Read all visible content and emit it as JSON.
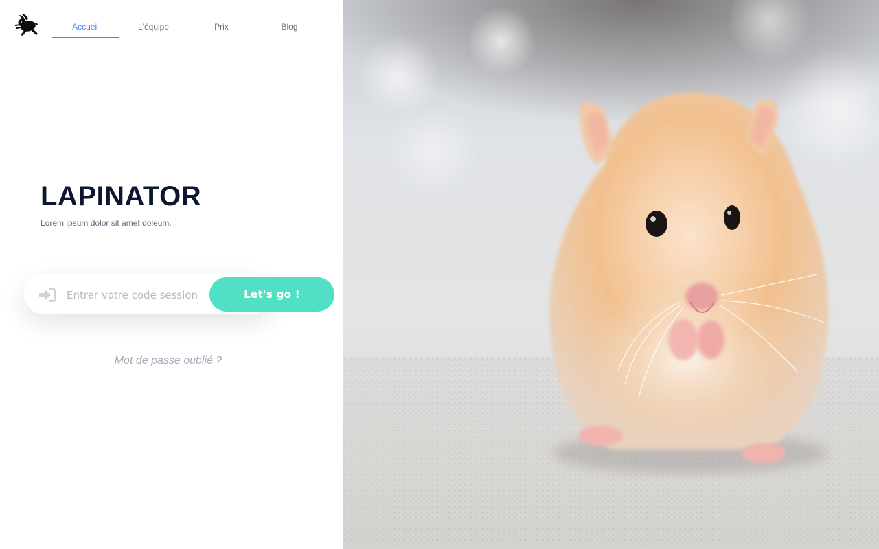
{
  "app": {
    "logo_icon": "running-rabbit-icon"
  },
  "nav": {
    "tabs": [
      {
        "label": "Accueil",
        "active": true
      },
      {
        "label": "L'équipe",
        "active": false
      },
      {
        "label": "Prix",
        "active": false
      },
      {
        "label": "Blog",
        "active": false
      }
    ]
  },
  "hero": {
    "title": "LAPINATOR",
    "subtitle": "Lorem ipsum dolor sit amet doleum."
  },
  "session": {
    "icon": "sign-in-icon",
    "placeholder": "Entrer votre code session",
    "value": "",
    "button_label": "Let's go !"
  },
  "forgot_password": {
    "label": "Mot de passe oublié ?"
  },
  "photo": {
    "subject": "hamster-photo"
  },
  "colors": {
    "accent_blue": "#3f8cf0",
    "button_teal": "#52e0c4",
    "title_navy": "#0d1530",
    "muted_text": "#a9adba"
  }
}
